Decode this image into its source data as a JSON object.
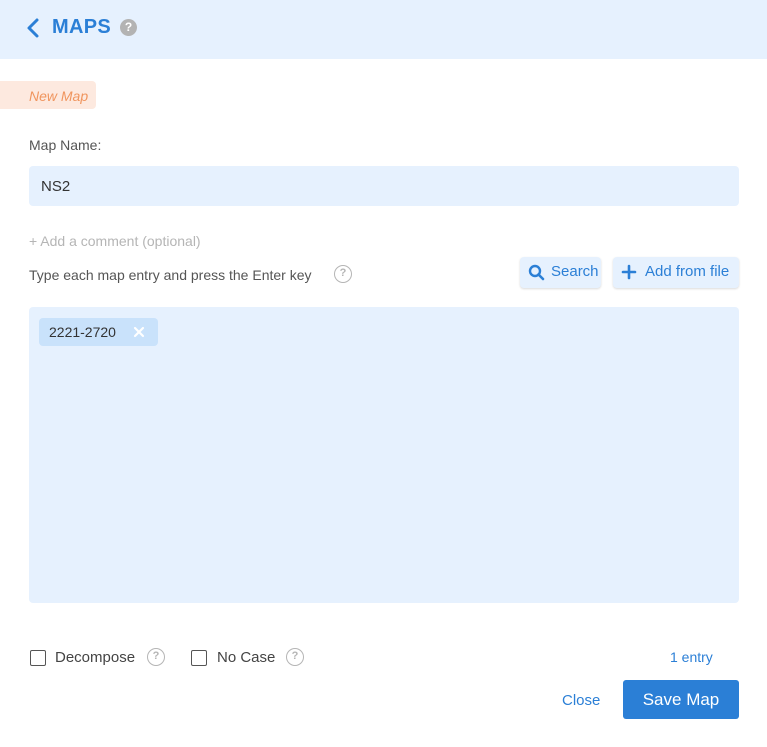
{
  "header": {
    "title": "MAPS",
    "help_glyph": "?"
  },
  "badge": {
    "text": "New Map"
  },
  "form": {
    "name_label": "Map Name:",
    "name_value": "NS2",
    "add_comment": "+ Add a comment (optional)",
    "instruction": "Type each map entry and press the Enter key",
    "help_glyph": "?"
  },
  "toolbar": {
    "search_label": "Search",
    "add_from_file_label": "Add from file"
  },
  "entries": [
    {
      "value": "2221-2720"
    }
  ],
  "options": {
    "decompose_label": "Decompose",
    "decompose_checked": false,
    "nocase_label": "No Case",
    "nocase_checked": false
  },
  "footer": {
    "entry_count": "1 entry",
    "close_label": "Close",
    "save_label": "Save Map"
  },
  "colors": {
    "accent": "#2b7fd6",
    "panel": "#e6f1fe",
    "chip": "#c9e2fb",
    "badge_bg": "#fde9df",
    "badge_text": "#f0955e"
  },
  "icons": {
    "back": "chevron-left-icon",
    "help": "question-circle-icon",
    "search": "magnifier-icon",
    "add": "plus-icon",
    "remove": "close-x-icon"
  }
}
